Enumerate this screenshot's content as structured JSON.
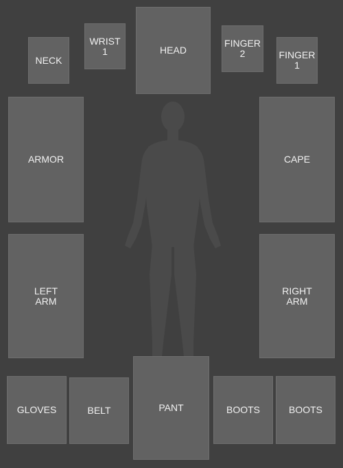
{
  "slots": {
    "neck": "NECK",
    "wrist_1": "WRIST\n1",
    "head": "HEAD",
    "finger_2": "FINGER\n2",
    "finger_1": "FINGER\n1",
    "armor": "ARMOR",
    "cape": "CAPE",
    "left_arm": "LEFT\nARM",
    "right_arm": "RIGHT\nARM",
    "gloves": "GLOVES",
    "belt": "BELT",
    "pant": "PANT",
    "boots_1": "BOOTS",
    "boots_2": "BOOTS"
  },
  "colors": {
    "background": "#404040",
    "slot": "#626262",
    "silhouette": "#4a4a4a",
    "text": "#f2f2f2"
  }
}
